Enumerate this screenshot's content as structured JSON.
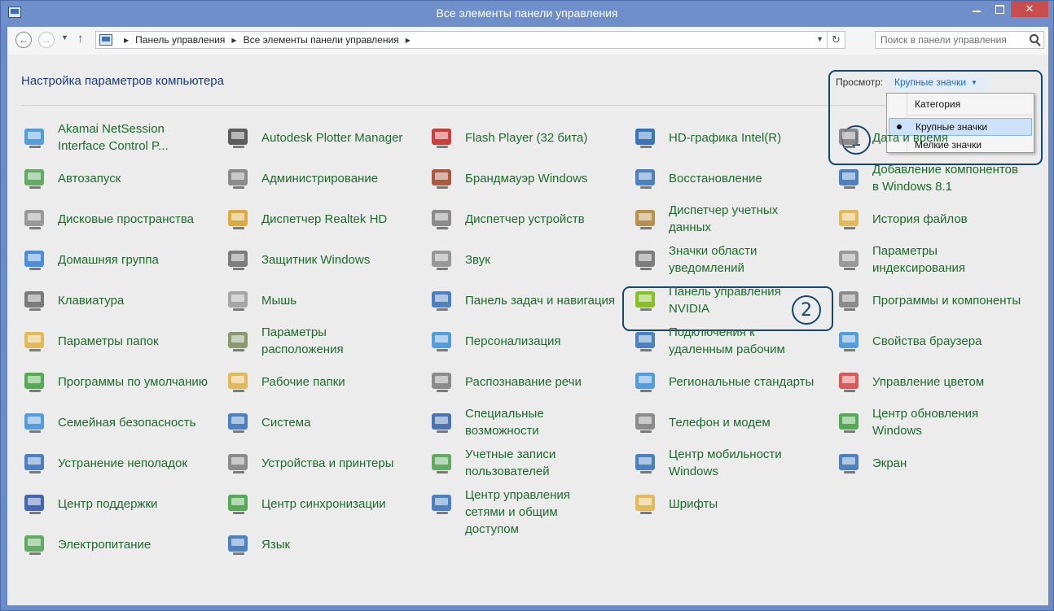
{
  "window": {
    "title": "Все элементы панели управления"
  },
  "address": {
    "crumbs": [
      "Панель управления",
      "Все элементы панели управления"
    ],
    "search_placeholder": "Поиск в панели управления"
  },
  "header": {
    "title": "Настройка параметров компьютера",
    "view_label": "Просмотр:",
    "view_value": "Крупные значки",
    "view_options": [
      "Категория",
      "Крупные значки",
      "Мелкие значки"
    ]
  },
  "callouts": [
    "1",
    "2"
  ],
  "colors": {
    "link_text": "#1f6b2e",
    "accent": "#1c6fc9",
    "callout": "#14466e"
  },
  "columns": [
    [
      {
        "label": "Akamai NetSession Interface Control P...",
        "icon": "akamai-icon",
        "color": "#3a8fd8"
      },
      {
        "label": "Автозапуск",
        "icon": "autoplay-icon",
        "color": "#4aa04a"
      },
      {
        "label": "Дисковые пространства",
        "icon": "storage-spaces-icon",
        "color": "#8a8a8a"
      },
      {
        "label": "Домашняя группа",
        "icon": "homegroup-icon",
        "color": "#2f7ed8"
      },
      {
        "label": "Клавиатура",
        "icon": "keyboard-icon",
        "color": "#666666"
      },
      {
        "label": "Параметры папок",
        "icon": "folder-options-icon",
        "color": "#e0b040"
      },
      {
        "label": "Программы по умолчанию",
        "icon": "default-programs-icon",
        "color": "#3aa03a"
      },
      {
        "label": "Семейная безопасность",
        "icon": "family-safety-icon",
        "color": "#3a8fd8"
      },
      {
        "label": "Устранение неполадок",
        "icon": "troubleshooting-icon",
        "color": "#2f6fb8"
      },
      {
        "label": "Центр поддержки",
        "icon": "action-center-icon",
        "color": "#2a4fa8"
      },
      {
        "label": "Электропитание",
        "icon": "power-options-icon",
        "color": "#4aa04a"
      }
    ],
    [
      {
        "label": "Autodesk Plotter Manager",
        "icon": "plotter-icon",
        "color": "#444444"
      },
      {
        "label": "Администрирование",
        "icon": "admin-tools-icon",
        "color": "#7a7a7a"
      },
      {
        "label": "Диспетчер Realtek HD",
        "icon": "realtek-icon",
        "color": "#d8a020"
      },
      {
        "label": "Защитник Windows",
        "icon": "windows-defender-icon",
        "color": "#6a6a6a"
      },
      {
        "label": "Мышь",
        "icon": "mouse-icon",
        "color": "#9a9a9a"
      },
      {
        "label": "Параметры расположения",
        "icon": "location-icon",
        "color": "#7a8a5a"
      },
      {
        "label": "Рабочие папки",
        "icon": "work-folders-icon",
        "color": "#e0b040"
      },
      {
        "label": "Система",
        "icon": "system-icon",
        "color": "#2f6fb8"
      },
      {
        "label": "Устройства и принтеры",
        "icon": "devices-printers-icon",
        "color": "#7a7a7a"
      },
      {
        "label": "Центр синхронизации",
        "icon": "sync-center-icon",
        "color": "#3aa03a"
      },
      {
        "label": "Язык",
        "icon": "language-icon",
        "color": "#2f6fb8"
      }
    ],
    [
      {
        "label": "Flash Player (32 бита)",
        "icon": "flash-icon",
        "color": "#c42020"
      },
      {
        "label": "Брандмауэр Windows",
        "icon": "firewall-icon",
        "color": "#a04020"
      },
      {
        "label": "Диспетчер устройств",
        "icon": "device-manager-icon",
        "color": "#7a7a7a"
      },
      {
        "label": "Звук",
        "icon": "sound-icon",
        "color": "#8a8a8a"
      },
      {
        "label": "Панель задач и навигация",
        "icon": "taskbar-icon",
        "color": "#2f6fb8"
      },
      {
        "label": "Персонализация",
        "icon": "personalization-icon",
        "color": "#3a8fd8"
      },
      {
        "label": "Распознавание речи",
        "icon": "speech-icon",
        "color": "#7a7a7a"
      },
      {
        "label": "Специальные возможности",
        "icon": "ease-of-access-icon",
        "color": "#2f5fa8"
      },
      {
        "label": "Учетные записи пользователей",
        "icon": "user-accounts-icon",
        "color": "#4aa04a"
      },
      {
        "label": "Центр управления сетями и общим доступом",
        "icon": "network-center-icon",
        "color": "#2f6fb8"
      }
    ],
    [
      {
        "label": "HD-графика Intel(R)",
        "icon": "intel-icon",
        "color": "#1a5fb0"
      },
      {
        "label": "Восстановление",
        "icon": "recovery-icon",
        "color": "#2f6fb8"
      },
      {
        "label": "Диспетчер учетных данных",
        "icon": "credential-manager-icon",
        "color": "#b08030"
      },
      {
        "label": "Значки области уведомлений",
        "icon": "notification-icons-icon",
        "color": "#6a6a6a"
      },
      {
        "label": "Панель управления NVIDIA",
        "icon": "nvidia-icon",
        "color": "#76b900"
      },
      {
        "label": "Подключения к удаленным рабочим",
        "icon": "remote-desktop-icon",
        "color": "#2f6fb8"
      },
      {
        "label": "Региональные стандарты",
        "icon": "region-icon",
        "color": "#3a8fd8"
      },
      {
        "label": "Телефон и модем",
        "icon": "phone-modem-icon",
        "color": "#7a7a7a"
      },
      {
        "label": "Центр мобильности Windows",
        "icon": "mobility-center-icon",
        "color": "#2f6fb8"
      },
      {
        "label": "Шрифты",
        "icon": "fonts-icon",
        "color": "#e0b040"
      }
    ],
    [
      {
        "label": "Дата и время",
        "icon": "date-time-icon",
        "color": "#7a7a7a"
      },
      {
        "label": "Добавление компонентов в Windows 8.1",
        "icon": "add-features-icon",
        "color": "#2f6fb8"
      },
      {
        "label": "История файлов",
        "icon": "file-history-icon",
        "color": "#e0b040"
      },
      {
        "label": "Параметры индексирования",
        "icon": "indexing-icon",
        "color": "#8a8a8a"
      },
      {
        "label": "Программы и компоненты",
        "icon": "programs-features-icon",
        "color": "#7a7a7a"
      },
      {
        "label": "Свойства браузера",
        "icon": "internet-options-icon",
        "color": "#3a8fd8"
      },
      {
        "label": "Управление цветом",
        "icon": "color-management-icon",
        "color": "#d84040"
      },
      {
        "label": "Центр обновления Windows",
        "icon": "windows-update-icon",
        "color": "#3aa03a"
      },
      {
        "label": "Экран",
        "icon": "display-icon",
        "color": "#2f6fb8"
      }
    ]
  ]
}
